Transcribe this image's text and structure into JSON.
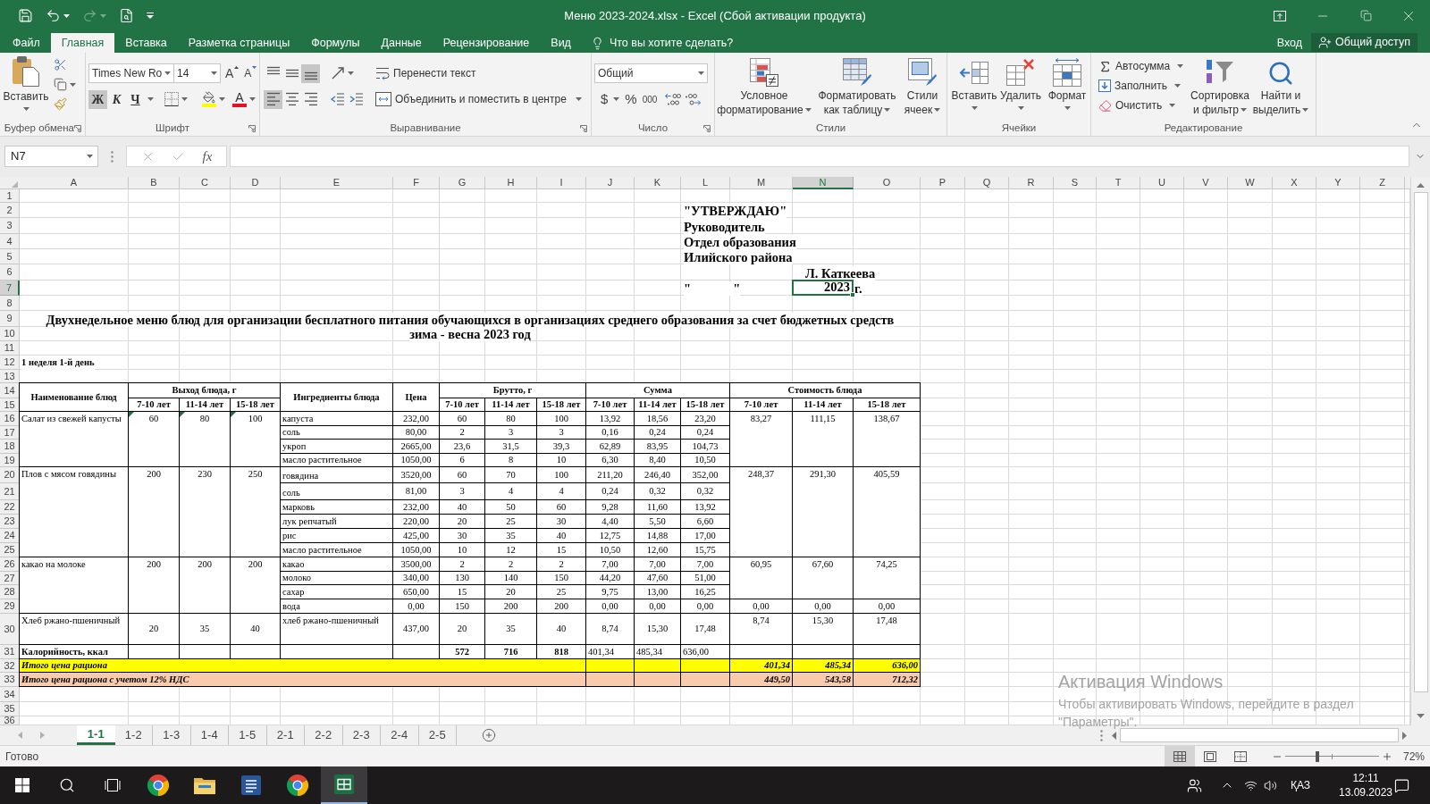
{
  "title_bar": {
    "quick_access": [
      {
        "kind": "save",
        "disabled": false
      },
      {
        "kind": "undo",
        "disabled": false
      },
      {
        "kind": "redo",
        "disabled": true
      },
      {
        "kind": "print_preview",
        "disabled": false
      }
    ],
    "title": "Меню 2023-2024.xlsx - Excel (Сбой активации продукта)"
  },
  "menu_tabs": [
    {
      "label": "Файл",
      "selected": false
    },
    {
      "label": "Главная",
      "selected": true
    },
    {
      "label": "Вставка",
      "selected": false
    },
    {
      "label": "Разметка страницы",
      "selected": false
    },
    {
      "label": "Формулы",
      "selected": false
    },
    {
      "label": "Данные",
      "selected": false
    },
    {
      "label": "Рецензирование",
      "selected": false
    },
    {
      "label": "Вид",
      "selected": false
    }
  ],
  "tell_me": {
    "placeholder": "Что вы хотите сделать?"
  },
  "account": {
    "sign_in": "Вход",
    "share": "Общий доступ"
  },
  "ribbon": {
    "clipboard": {
      "label": "Буфер обмена",
      "paste": "Вставить"
    },
    "font": {
      "label": "Шрифт",
      "font_name": "Times New Ro",
      "font_size": "14",
      "grow_font": "A",
      "shrink_font": "A",
      "styles": [
        {
          "kind": "bold",
          "label": "Ж",
          "on": true
        },
        {
          "kind": "italic",
          "label": "К",
          "on": false
        },
        {
          "kind": "underline",
          "label": "Ч",
          "on": false
        }
      ],
      "font_color": "A"
    },
    "alignment": {
      "label": "Выравнивание",
      "vertical": [
        {
          "kind": "top",
          "selected": false
        },
        {
          "kind": "middle",
          "selected": false
        },
        {
          "kind": "bottom",
          "selected": true
        }
      ],
      "horizontal": [
        {
          "kind": "left",
          "selected": true
        },
        {
          "kind": "center",
          "selected": false
        },
        {
          "kind": "right",
          "selected": false
        }
      ],
      "wrap_text": "Перенести текст",
      "merge": "Объединить и поместить в центре"
    },
    "number": {
      "label": "Число",
      "format": "Общий",
      "buttons": [
        "$",
        "%",
        "000"
      ]
    },
    "styles": {
      "label": "Стили",
      "buttons": [
        {
          "kind": "conditional",
          "lines": [
            "Условное",
            "форматирование"
          ]
        },
        {
          "kind": "table",
          "lines": [
            "Форматировать",
            "как таблицу"
          ]
        },
        {
          "kind": "cell_styles",
          "lines": [
            "Стили",
            "ячеек"
          ]
        }
      ]
    },
    "cells": {
      "label": "Ячейки",
      "buttons": [
        {
          "kind": "insert",
          "label": "Вставить"
        },
        {
          "kind": "delete",
          "label": "Удалить"
        },
        {
          "kind": "format",
          "label": "Формат"
        }
      ]
    },
    "editing": {
      "label": "Редактирование",
      "small_buttons": [
        {
          "kind": "autosum",
          "label": "Автосумма"
        },
        {
          "kind": "fill",
          "label": "Заполнить"
        },
        {
          "kind": "clear",
          "label": "Очистить"
        }
      ],
      "buttons": [
        {
          "kind": "sort",
          "lines": [
            "Сортировка",
            "и фильтр"
          ]
        },
        {
          "kind": "find",
          "lines": [
            "Найти и",
            "выделить"
          ]
        }
      ]
    }
  },
  "formula_bar": {
    "name_box": "N7",
    "function_label": "fx"
  },
  "sheet": {
    "columns": [
      {
        "label": "A",
        "selected": false
      },
      {
        "label": "B",
        "selected": false
      },
      {
        "label": "C",
        "selected": false
      },
      {
        "label": "D",
        "selected": false
      },
      {
        "label": "E",
        "selected": false
      },
      {
        "label": "F",
        "selected": false
      },
      {
        "label": "G",
        "selected": false
      },
      {
        "label": "H",
        "selected": false
      },
      {
        "label": "I",
        "selected": false
      },
      {
        "label": "J",
        "selected": false
      },
      {
        "label": "K",
        "selected": false
      },
      {
        "label": "L",
        "selected": false
      },
      {
        "label": "M",
        "selected": false
      },
      {
        "label": "N",
        "selected": true
      },
      {
        "label": "O",
        "selected": false
      },
      {
        "label": "P",
        "selected": false
      },
      {
        "label": "Q",
        "selected": false
      },
      {
        "label": "R",
        "selected": false
      },
      {
        "label": "S",
        "selected": false
      },
      {
        "label": "T",
        "selected": false
      },
      {
        "label": "U",
        "selected": false
      },
      {
        "label": "V",
        "selected": false
      },
      {
        "label": "W",
        "selected": false
      },
      {
        "label": "X",
        "selected": false
      },
      {
        "label": "Y",
        "selected": false
      },
      {
        "label": "Z",
        "selected": false
      }
    ],
    "rows": [
      {
        "label": "1",
        "selected": false
      },
      {
        "label": "2",
        "selected": false
      },
      {
        "label": "3",
        "selected": false
      },
      {
        "label": "4",
        "selected": false
      },
      {
        "label": "5",
        "selected": false
      },
      {
        "label": "6",
        "selected": false
      },
      {
        "label": "7",
        "selected": true
      },
      {
        "label": "8",
        "selected": false
      },
      {
        "label": "9",
        "selected": false
      },
      {
        "label": "10",
        "selected": false
      },
      {
        "label": "11",
        "selected": false
      },
      {
        "label": "12",
        "selected": false
      },
      {
        "label": "13",
        "selected": false
      },
      {
        "label": "14",
        "selected": false
      },
      {
        "label": "15",
        "selected": false
      },
      {
        "label": "16",
        "selected": false
      },
      {
        "label": "17",
        "selected": false
      },
      {
        "label": "18",
        "selected": false
      },
      {
        "label": "19",
        "selected": false
      },
      {
        "label": "20",
        "selected": false
      },
      {
        "label": "21",
        "selected": false
      },
      {
        "label": "22",
        "selected": false
      },
      {
        "label": "23",
        "selected": false
      },
      {
        "label": "24",
        "selected": false
      },
      {
        "label": "25",
        "selected": false
      },
      {
        "label": "26",
        "selected": false
      },
      {
        "label": "27",
        "selected": false
      },
      {
        "label": "28",
        "selected": false
      },
      {
        "label": "29",
        "selected": false
      },
      {
        "label": "30",
        "selected": false
      },
      {
        "label": "31",
        "selected": false
      },
      {
        "label": "32",
        "selected": false
      },
      {
        "label": "33",
        "selected": false
      },
      {
        "label": "34",
        "selected": false
      },
      {
        "label": "35",
        "selected": false
      },
      {
        "label": "36",
        "selected": false
      }
    ],
    "approval": {
      "lines": [
        "\"УТВЕРЖДАЮ\"",
        "Руководитель",
        "Отдел образования",
        "Илийского района"
      ],
      "signatory": "Л. Каткеева",
      "date_blank": "\"             \"",
      "year": {
        "text": "2023",
        "selected": true
      },
      "year_suffix": "г."
    },
    "title_lines": [
      "Двухнедельное меню блюд для организации бесплатного питания обучающихся в организациях среднего образования за счет бюджетных средств",
      "зима - весна 2023 год"
    ],
    "day_label": "1 неделя 1-й день",
    "table": {
      "header": {
        "dish": "Наименование блюд",
        "output": {
          "title": "Выход блюда, г",
          "ages": [
            "7-10 лет",
            "11-14 лет",
            "15-18 лет"
          ]
        },
        "ingredients": "Ингредиенты блюда",
        "price": "Цена",
        "gross": {
          "title": "Брутто, г",
          "ages": [
            "7-10 лет",
            "11-14 лет",
            "15-18 лет"
          ]
        },
        "sum": {
          "title": "Сумма",
          "ages": [
            "7-10 лет",
            "11-14 лет",
            "15-18 лет"
          ]
        },
        "cost": {
          "title": "Стоимость блюда",
          "ages": [
            "7-10 лет",
            "11-14 лет",
            "15-18 лет"
          ]
        }
      },
      "dishes": [
        {
          "name": "Салат из свежей капусты",
          "output": [
            "60",
            "80",
            "100"
          ],
          "flagged": true,
          "blocks": [
            {
              "cost": [
                "83,27",
                "111,15",
                "138,67"
              ],
              "ingredients": [
                {
                  "name": "капуста",
                  "price": "232,00",
                  "gross": [
                    "60",
                    "80",
                    "100"
                  ],
                  "sum": [
                    "13,92",
                    "18,56",
                    "23,20"
                  ]
                },
                {
                  "name": "соль",
                  "price": "80,00",
                  "gross": [
                    "2",
                    "3",
                    "3"
                  ],
                  "sum": [
                    "0,16",
                    "0,24",
                    "0,24"
                  ]
                },
                {
                  "name": "укроп",
                  "price": "2665,00",
                  "gross": [
                    "23,6",
                    "31,5",
                    "39,3"
                  ],
                  "sum": [
                    "62,89",
                    "83,95",
                    "104,73"
                  ]
                },
                {
                  "name": "масло растительное",
                  "price": "1050,00",
                  "gross": [
                    "6",
                    "8",
                    "10"
                  ],
                  "sum": [
                    "6,30",
                    "8,40",
                    "10,50"
                  ]
                }
              ]
            }
          ]
        },
        {
          "name": "Плов с мясом говядины",
          "output": [
            "200",
            "230",
            "250"
          ],
          "flagged": false,
          "blocks": [
            {
              "cost": [
                "248,37",
                "291,30",
                "405,59"
              ],
              "ingredients": [
                {
                  "name": "говядина",
                  "price": "3520,00",
                  "gross": [
                    "60",
                    "70",
                    "100"
                  ],
                  "sum": [
                    "211,20",
                    "246,40",
                    "352,00"
                  ]
                },
                {
                  "name": "соль",
                  "price": "81,00",
                  "gross": [
                    "3",
                    "4",
                    "4"
                  ],
                  "sum": [
                    "0,24",
                    "0,32",
                    "0,32"
                  ]
                },
                {
                  "name": "марковь",
                  "price": "232,00",
                  "gross": [
                    "40",
                    "50",
                    "60"
                  ],
                  "sum": [
                    "9,28",
                    "11,60",
                    "13,92"
                  ]
                },
                {
                  "name": "лук репчатый",
                  "price": "220,00",
                  "gross": [
                    "20",
                    "25",
                    "30"
                  ],
                  "sum": [
                    "4,40",
                    "5,50",
                    "6,60"
                  ]
                },
                {
                  "name": "рис",
                  "price": "425,00",
                  "gross": [
                    "30",
                    "35",
                    "40"
                  ],
                  "sum": [
                    "12,75",
                    "14,88",
                    "17,00"
                  ]
                },
                {
                  "name": "масло растительное",
                  "price": "1050,00",
                  "gross": [
                    "10",
                    "12",
                    "15"
                  ],
                  "sum": [
                    "10,50",
                    "12,60",
                    "15,75"
                  ]
                }
              ]
            }
          ]
        },
        {
          "name": "какао на молоке",
          "output": [
            "200",
            "200",
            "200"
          ],
          "flagged": false,
          "blocks": [
            {
              "cost": [
                "60,95",
                "67,60",
                "74,25"
              ],
              "ingredients": [
                {
                  "name": "какао",
                  "price": "3500,00",
                  "gross": [
                    "2",
                    "2",
                    "2"
                  ],
                  "sum": [
                    "7,00",
                    "7,00",
                    "7,00"
                  ]
                },
                {
                  "name": "молоко",
                  "price": "340,00",
                  "gross": [
                    "130",
                    "140",
                    "150"
                  ],
                  "sum": [
                    "44,20",
                    "47,60",
                    "51,00"
                  ]
                },
                {
                  "name": "сахар",
                  "price": "650,00",
                  "gross": [
                    "15",
                    "20",
                    "25"
                  ],
                  "sum": [
                    "9,75",
                    "13,00",
                    "16,25"
                  ]
                }
              ]
            },
            {
              "cost": [
                "0,00",
                "0,00",
                "0,00"
              ],
              "ingredients": [
                {
                  "name": "вода",
                  "price": "0,00",
                  "gross": [
                    "150",
                    "200",
                    "200"
                  ],
                  "sum": [
                    "0,00",
                    "0,00",
                    "0,00"
                  ]
                }
              ]
            }
          ]
        },
        {
          "name": "Хлеб ржано-пшеничный",
          "output": [
            "20",
            "35",
            "40"
          ],
          "flagged": false,
          "blocks": [
            {
              "cost": [
                "8,74",
                "15,30",
                "17,48"
              ],
              "ingredients": [
                {
                  "name": "хлеб ржано-пшеничный",
                  "price": "437,00",
                  "gross": [
                    "20",
                    "35",
                    "40"
                  ],
                  "sum": [
                    "8,74",
                    "15,30",
                    "17,48"
                  ]
                }
              ]
            }
          ]
        }
      ],
      "calories": {
        "label": "Калорийность, ккал",
        "gross": [
          "572",
          "716",
          "818"
        ],
        "sum": [
          "401,34",
          "485,34",
          "636,00"
        ]
      },
      "totals": [
        {
          "label": "Итого цена рациона",
          "values": [
            "401,34",
            "485,34",
            "636,00"
          ],
          "color": "#ffff00"
        },
        {
          "label": "Итого цена рациона с учетом 12% НДС",
          "values": [
            "449,50",
            "543,58",
            "712,32"
          ],
          "color": "#f8cbad"
        }
      ]
    }
  },
  "sheet_tabs": [
    {
      "label": "1-1",
      "selected": true
    },
    {
      "label": "1-2",
      "selected": false
    },
    {
      "label": "1-3",
      "selected": false
    },
    {
      "label": "1-4",
      "selected": false
    },
    {
      "label": "1-5",
      "selected": false
    },
    {
      "label": "2-1",
      "selected": false
    },
    {
      "label": "2-2",
      "selected": false
    },
    {
      "label": "2-3",
      "selected": false
    },
    {
      "label": "2-4",
      "selected": false
    },
    {
      "label": "2-5",
      "selected": false
    }
  ],
  "status_bar": {
    "text": "Готово",
    "views": [
      {
        "kind": "normal",
        "selected": true
      },
      {
        "kind": "page_layout",
        "selected": false
      },
      {
        "kind": "page_break",
        "selected": false
      }
    ],
    "zoom_slider": {
      "level": 0.34
    },
    "zoom": "72%"
  },
  "activation_notice": {
    "title": "Активация Windows",
    "lines": [
      "Чтобы активировать Windows, перейдите в раздел",
      "\"Параметры\"."
    ]
  },
  "taskbar": {
    "apps": [
      {
        "kind": "chrome",
        "active": false
      },
      {
        "kind": "explorer",
        "active": false
      },
      {
        "kind": "word",
        "active": false
      },
      {
        "kind": "chrome",
        "active": false
      },
      {
        "kind": "excel",
        "active": true
      }
    ],
    "language": "ҚАЗ",
    "time": "12:11",
    "date": "13.09.2023"
  }
}
